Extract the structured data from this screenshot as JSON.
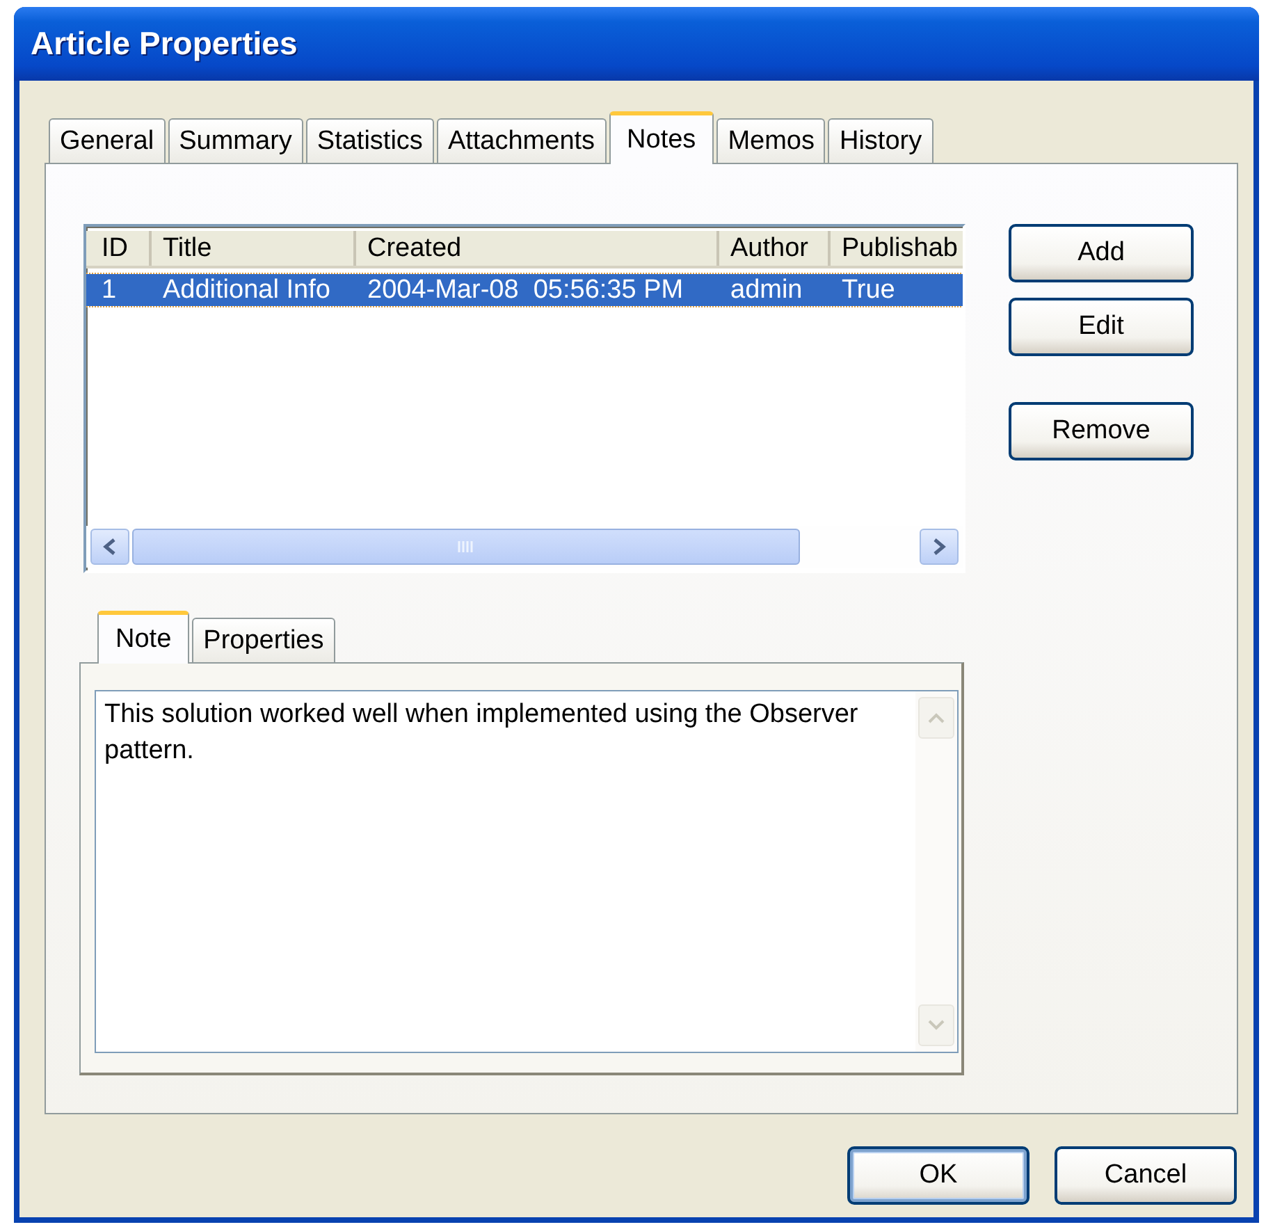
{
  "window": {
    "title": "Article Properties"
  },
  "tabs": [
    {
      "label": "General",
      "selected": false
    },
    {
      "label": "Summary",
      "selected": false
    },
    {
      "label": "Statistics",
      "selected": false
    },
    {
      "label": "Attachments",
      "selected": false
    },
    {
      "label": "Notes",
      "selected": true
    },
    {
      "label": "Memos",
      "selected": false
    },
    {
      "label": "History",
      "selected": false
    }
  ],
  "notes_list": {
    "columns": [
      "ID",
      "Title",
      "Created",
      "Author",
      "Publishab"
    ],
    "rows": [
      {
        "cells": [
          "1",
          "Additional Info",
          "2004-Mar-08  05:56:35 PM",
          "admin",
          "True"
        ],
        "selected": true
      }
    ]
  },
  "side_buttons": [
    "Add",
    "Edit",
    "Remove"
  ],
  "detail_tabs": [
    {
      "label": "Note",
      "selected": true
    },
    {
      "label": "Properties",
      "selected": false
    }
  ],
  "note": {
    "value": "This solution worked well when implemented using the Observer pattern."
  },
  "buttons": [
    {
      "label": "OK",
      "default": true
    },
    {
      "label": "Cancel",
      "default": false
    }
  ]
}
